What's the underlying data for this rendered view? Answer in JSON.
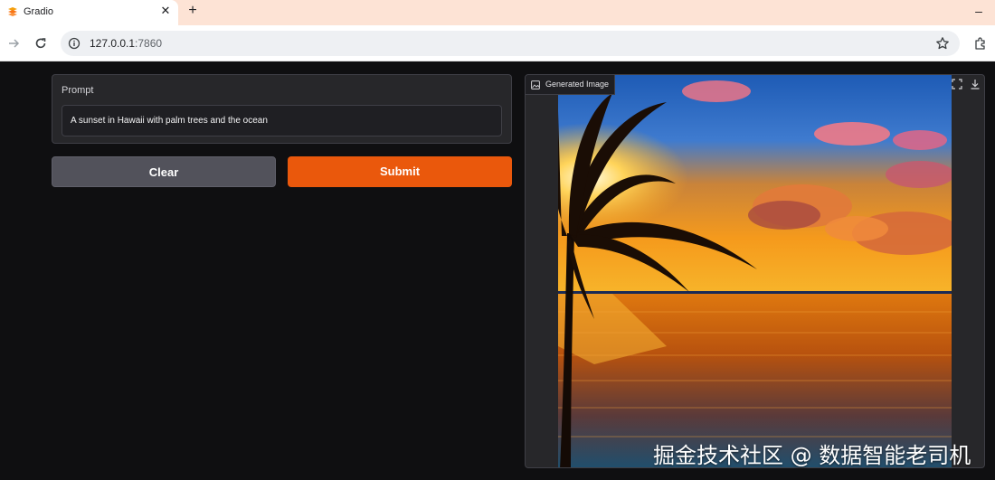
{
  "browser": {
    "tab_title": "Gradio",
    "url_host": "127.0.0.1",
    "url_port": ":7860",
    "icons": [
      "gradio-favicon-icon",
      "close-icon",
      "plus-icon",
      "minimize-icon",
      "back-arrow-icon",
      "reload-icon",
      "info-icon",
      "star-icon",
      "extensions-icon"
    ]
  },
  "prompt": {
    "label": "Prompt",
    "value": "A sunset in Hawaii with palm trees and the ocean"
  },
  "buttons": {
    "clear_label": "Clear",
    "submit_label": "Submit"
  },
  "output": {
    "label": "Generated Image",
    "icons": [
      "image-icon",
      "fullscreen-icon",
      "download-icon"
    ]
  },
  "watermark": "掘金技术社区 @ 数据智能老司机",
  "colors": {
    "background": "#0f0f11",
    "panel": "#27272a",
    "submit": "#ea580c",
    "clear": "#52525b",
    "tabbar": "#fde3d5"
  }
}
